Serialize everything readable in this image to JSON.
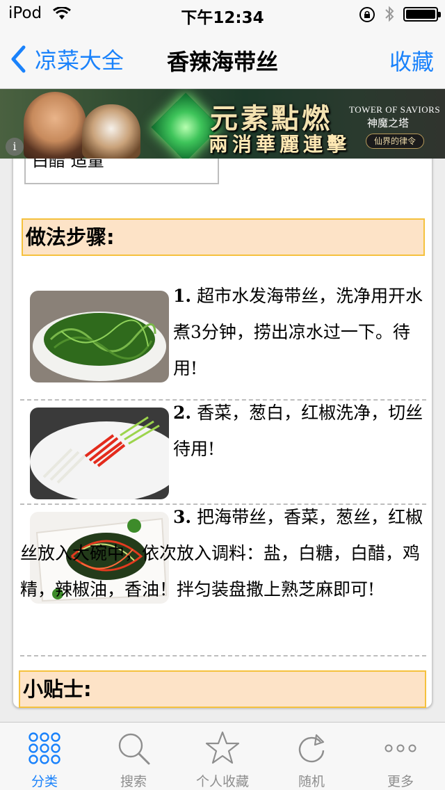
{
  "status_bar": {
    "carrier": "iPod",
    "time": "下午12:34"
  },
  "nav": {
    "back_label": "凉菜大全",
    "title": "香辣海带丝",
    "right_label": "收藏"
  },
  "ad": {
    "line1": "元素點燃",
    "line2": "兩消華麗連擊",
    "brand": "TOWER OF SAVIORS",
    "brand_cn": "神魔之塔",
    "brand_tag": "仙界的律令",
    "info": "i"
  },
  "ingredients": {
    "last_visible": "白醋 适量"
  },
  "steps_section": {
    "title": "做法步骤:"
  },
  "steps": [
    {
      "num": "1.",
      "text": "超市水发海带丝，洗净用开水煮3分钟，捞出凉水过一下。待用!"
    },
    {
      "num": "2.",
      "text": "香菜，葱白，红椒洗净，切丝待用!"
    },
    {
      "num": "3.",
      "text": "把海带丝，香菜，葱丝，红椒丝放入大碗中，依次放入调料：盐，白糖，白醋，鸡精，辣椒油，香油！拌匀装盘撒上熟芝麻即可!"
    }
  ],
  "tips_section": {
    "title": "小贴士:"
  },
  "tabs": [
    {
      "label": "分类",
      "icon": "grid-icon",
      "active": true
    },
    {
      "label": "搜索",
      "icon": "search-icon",
      "active": false
    },
    {
      "label": "个人收藏",
      "icon": "star-icon",
      "active": false
    },
    {
      "label": "随机",
      "icon": "refresh-icon",
      "active": false
    },
    {
      "label": "更多",
      "icon": "more-icon",
      "active": false
    }
  ],
  "colors": {
    "accent": "#1a82fb",
    "section_bg": "#fde3c7",
    "section_border": "#f5c13d"
  }
}
